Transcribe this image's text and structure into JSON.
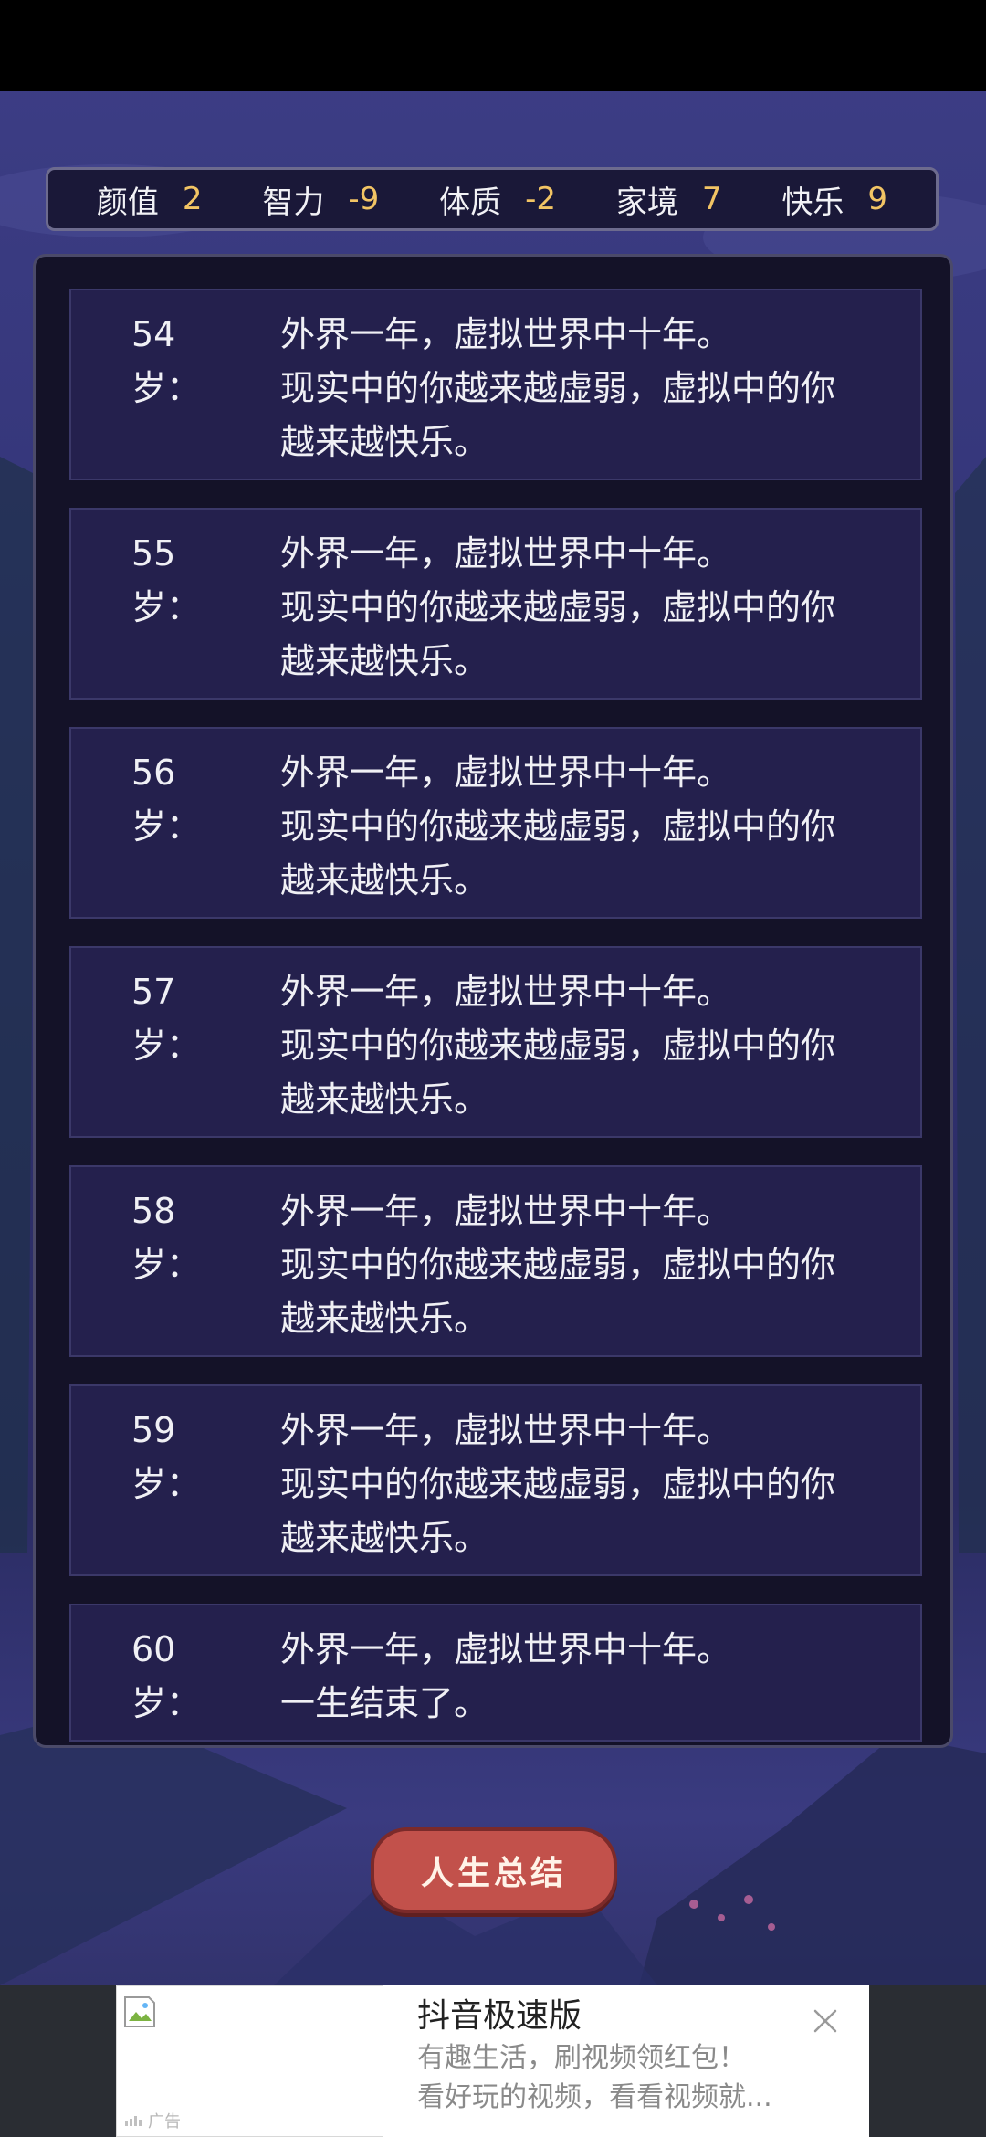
{
  "stats": [
    {
      "label": "颜值",
      "value": "2"
    },
    {
      "label": "智力",
      "value": "-9"
    },
    {
      "label": "体质",
      "value": "-2"
    },
    {
      "label": "家境",
      "value": "7"
    },
    {
      "label": "快乐",
      "value": "9"
    }
  ],
  "log": [
    {
      "age": "54岁：",
      "lines": [
        "外界一年，虚拟世界中十年。",
        "现实中的你越来越虚弱，虚拟中的你",
        "越来越快乐。"
      ]
    },
    {
      "age": "55岁：",
      "lines": [
        "外界一年，虚拟世界中十年。",
        "现实中的你越来越虚弱，虚拟中的你",
        "越来越快乐。"
      ]
    },
    {
      "age": "56岁：",
      "lines": [
        "外界一年，虚拟世界中十年。",
        "现实中的你越来越虚弱，虚拟中的你",
        "越来越快乐。"
      ]
    },
    {
      "age": "57岁：",
      "lines": [
        "外界一年，虚拟世界中十年。",
        "现实中的你越来越虚弱，虚拟中的你",
        "越来越快乐。"
      ]
    },
    {
      "age": "58岁：",
      "lines": [
        "外界一年，虚拟世界中十年。",
        "现实中的你越来越虚弱，虚拟中的你",
        "越来越快乐。"
      ]
    },
    {
      "age": "59岁：",
      "lines": [
        "外界一年，虚拟世界中十年。",
        "现实中的你越来越虚弱，虚拟中的你",
        "越来越快乐。"
      ]
    },
    {
      "age": "60岁：",
      "lines": [
        "外界一年，虚拟世界中十年。",
        "一生结束了。"
      ]
    }
  ],
  "summary_button": {
    "label": "人生总结"
  },
  "ad": {
    "title": "抖音极速版",
    "desc_line1": "有趣生活，刷视频领红包！",
    "desc_line2": "看好玩的视频，看看视频就...",
    "mark": "广告",
    "icons": {
      "broken_image": "broken-image-icon",
      "close": "close-icon",
      "ad_mark": "ad-mark-icon"
    }
  },
  "colors": {
    "stat_value": "#f2c464",
    "entry_bg": "#24204d",
    "button": "#c2514b"
  }
}
